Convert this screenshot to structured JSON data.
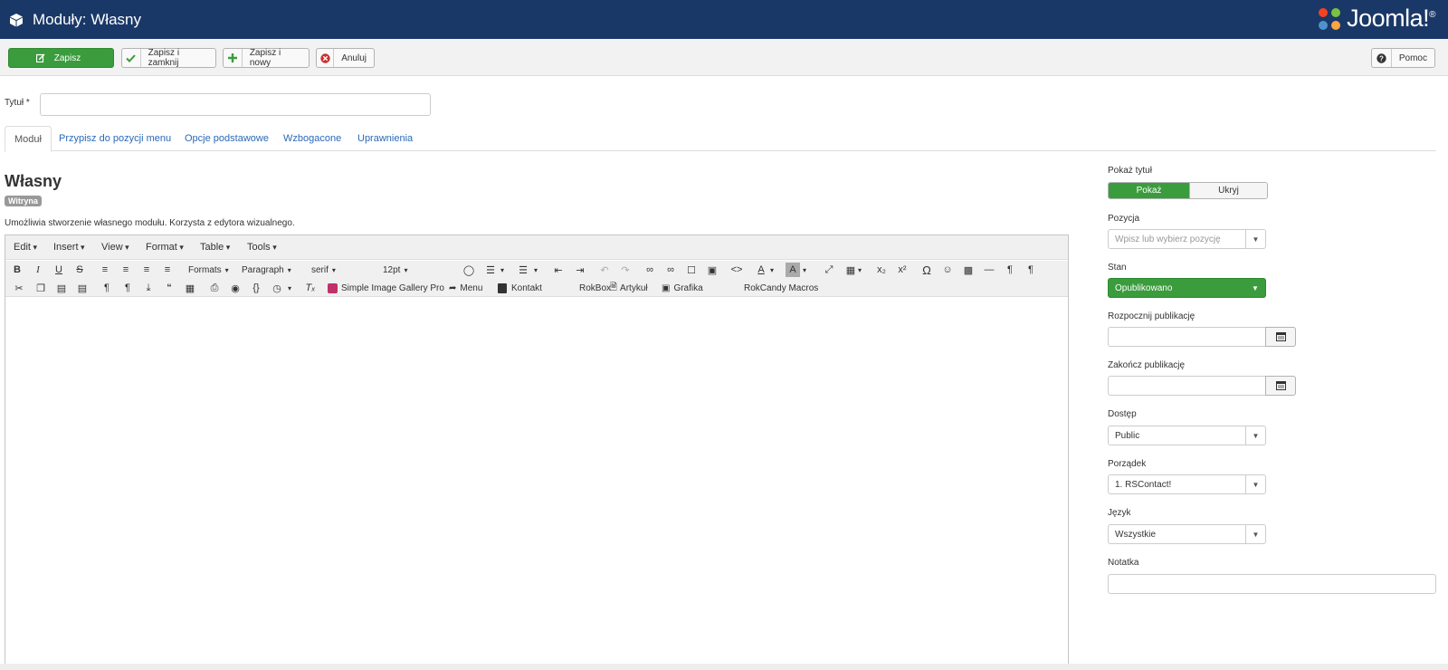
{
  "header": {
    "title": "Moduły: Własny",
    "logo_text": "Joomla!",
    "logo_reg": "®"
  },
  "toolbar": {
    "save": "Zapisz",
    "save_close": "Zapisz i zamknij",
    "save_new": "Zapisz i nowy",
    "cancel": "Anuluj",
    "help": "Pomoc"
  },
  "form": {
    "title_label": "Tytuł *",
    "title_value": ""
  },
  "tabs": [
    "Moduł",
    "Przypisz do pozycji menu",
    "Opcje podstawowe",
    "Wzbogacone",
    "Uprawnienia"
  ],
  "module": {
    "name": "Własny",
    "badge": "Witryna",
    "description": "Umożliwia stworzenie własnego modułu. Korzysta z edytora wizualnego."
  },
  "editor": {
    "menus": [
      "Edit",
      "Insert",
      "View",
      "Format",
      "Table",
      "Tools"
    ],
    "formats": "Formats",
    "block": "Paragraph",
    "font": "serif",
    "size": "12pt",
    "plugins": {
      "gallery": "Simple Image Gallery Pro",
      "menu": "Menu",
      "contact": "Kontakt",
      "rokbox": "RokBox",
      "article": "Artykuł",
      "image": "Grafika",
      "rokcandy": "RokCandy Macros"
    }
  },
  "sidebar": {
    "show_title": {
      "label": "Pokaż tytuł",
      "on": "Pokaż",
      "off": "Ukryj"
    },
    "position": {
      "label": "Pozycja",
      "placeholder": "Wpisz lub wybierz pozycję"
    },
    "state": {
      "label": "Stan",
      "value": "Opublikowano"
    },
    "publish_up": {
      "label": "Rozpocznij publikację",
      "value": ""
    },
    "publish_down": {
      "label": "Zakończ publikację",
      "value": ""
    },
    "access": {
      "label": "Dostęp",
      "value": "Public"
    },
    "ordering": {
      "label": "Porządek",
      "value": "1. RSContact!"
    },
    "language": {
      "label": "Język",
      "value": "Wszystkie"
    },
    "note": {
      "label": "Notatka",
      "value": ""
    }
  },
  "colors": {
    "header_bg": "#1a3867",
    "success": "#3a9c3d",
    "link": "#2a69b8"
  }
}
